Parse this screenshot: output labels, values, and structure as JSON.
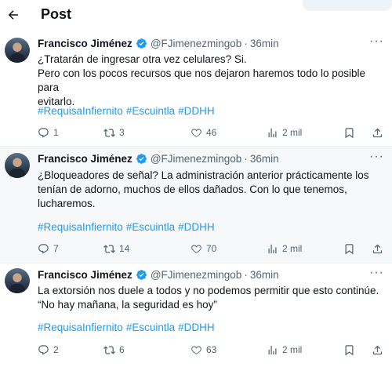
{
  "header": {
    "title": "Post"
  },
  "tweets": [
    {
      "author": "Francisco Jiménez",
      "handle": "@FJimenezmingob",
      "time": "36min",
      "text_lines": [
        "¿Tratarán de ingresar otra vez celulares? Si.",
        "Pero con los pocos recursos que nos dejaron haremos todo lo posible para",
        "evitarlo."
      ],
      "hashtags": [
        "#RequisaInfierni to",
        "#Escuintla",
        "#DDHH"
      ],
      "replies": "1",
      "reposts": "3",
      "likes": "46",
      "views": "2 mil"
    },
    {
      "author": "Francisco Jiménez",
      "handle": "@FJimenezmingob",
      "time": "36min",
      "text_lines": [
        "¿Bloqueadores de señal? La administración anterior prácticamente los",
        "tenían de adorno, muchos de ellos dañados. Con lo que tenemos,",
        "lucharemos."
      ],
      "hashtags": [
        "#RequisaInfierni to",
        "#Escuintla",
        "#DDHH"
      ],
      "replies": "7",
      "reposts": "14",
      "likes": "70",
      "views": "2 mil"
    },
    {
      "author": "Francisco Jiménez",
      "handle": "@FJimenezmingob",
      "time": "36min",
      "text_lines": [
        "La extorsión nos duele a todos y no podemos permitir que esto continúe.",
        "“No hay mañana, la seguridad es hoy”"
      ],
      "hashtags": [
        "#RequisaInfierni to",
        "#Escuintla",
        "#DDHH"
      ],
      "replies": "2",
      "reposts": "6",
      "likes": "63",
      "views": "2 mil"
    }
  ],
  "colors": {
    "accent": "#1d9bf0",
    "muted": "#536471",
    "text": "#0f1419",
    "highlight_bg": "#f7f8f9"
  }
}
